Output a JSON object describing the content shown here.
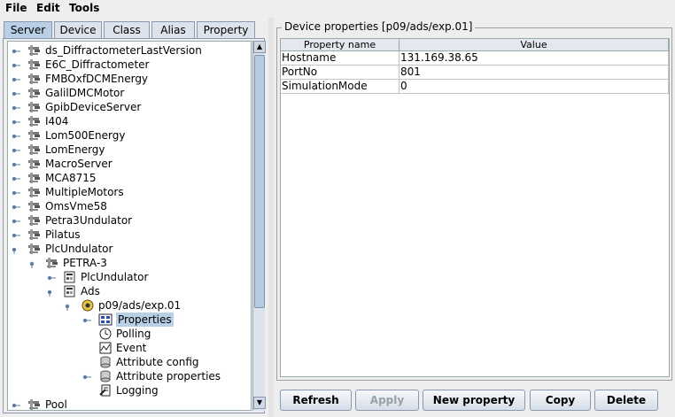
{
  "menubar": {
    "file": "File",
    "edit": "Edit",
    "tools": "Tools"
  },
  "tabs": [
    "Server",
    "Device",
    "Class",
    "Alias",
    "Property"
  ],
  "tree": {
    "servers": [
      "ds_DiffractometerLastVersion",
      "E6C_Diffractometer",
      "FMBOxfDCMEnergy",
      "GalilDMCMotor",
      "GpibDeviceServer",
      "I404",
      "Lom500Energy",
      "LomEnergy",
      "MacroServer",
      "MCA8715",
      "MultipleMotors",
      "OmsVme58",
      "Petra3Undulator",
      "Pilatus",
      "PlcUndulator"
    ],
    "instance": "PETRA-3",
    "classes": [
      "PlcUndulator",
      "Ads"
    ],
    "device": "p09/ads/exp.01",
    "device_nodes": [
      "Properties",
      "Polling",
      "Event",
      "Attribute config",
      "Attribute properties",
      "Logging"
    ],
    "last_server": "Pool"
  },
  "properties_panel": {
    "title": "Device properties [p09/ads/exp.01]",
    "columns": [
      "Property name",
      "Value"
    ],
    "rows": [
      {
        "name": "Hostname",
        "value": "131.169.38.65"
      },
      {
        "name": "PortNo",
        "value": "801"
      },
      {
        "name": "SimulationMode",
        "value": "0"
      }
    ]
  },
  "buttons": {
    "refresh": "Refresh",
    "apply": "Apply",
    "new_property": "New property",
    "copy": "Copy",
    "delete": "Delete"
  },
  "colors": {
    "selection": "#b8cfe5",
    "accent": "#8a99b0"
  },
  "icons": {
    "server": "server-icon",
    "class": "class-icon",
    "device": "device-icon",
    "properties": "properties-icon",
    "polling": "clock-icon",
    "event": "event-icon",
    "attribute": "database-icon",
    "logging": "logging-icon"
  }
}
